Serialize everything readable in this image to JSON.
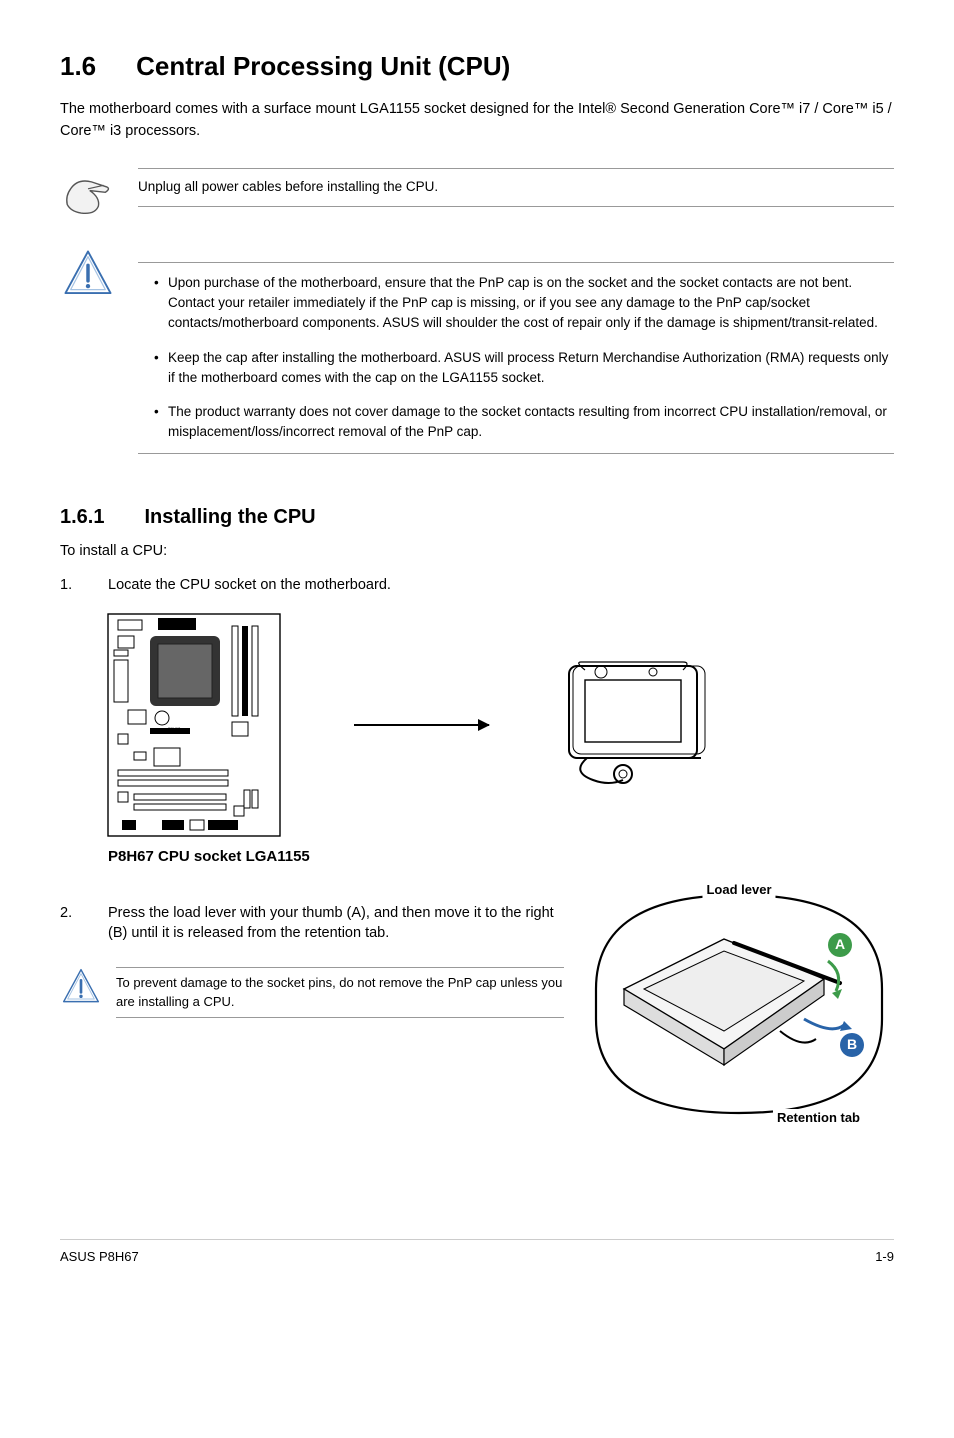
{
  "section": {
    "number": "1.6",
    "title": "Central Processing Unit (CPU)"
  },
  "intro": "The motherboard comes with a surface mount LGA1155 socket designed for the Intel® Second Generation Core™ i7 / Core™ i5 / Core™ i3 processors.",
  "pointing_note": "Unplug all power cables before installing the CPU.",
  "caution_bullets": [
    "Upon purchase of the motherboard, ensure that the PnP cap is on the socket and the socket contacts are not bent. Contact your retailer immediately if the PnP cap is missing, or if you see any damage to the PnP cap/socket contacts/motherboard components. ASUS will shoulder the cost of repair only if the damage is shipment/transit-related.",
    "Keep the cap after installing the motherboard. ASUS will process Return Merchandise Authorization (RMA) requests only if the motherboard comes with the cap on the LGA1155 socket.",
    "The product warranty does not cover damage to the socket contacts resulting from incorrect CPU installation/removal, or misplacement/loss/incorrect removal of the PnP cap."
  ],
  "subsection": {
    "number": "1.6.1",
    "title": "Installing the CPU"
  },
  "install_intro": "To install a CPU:",
  "steps": {
    "s1_num": "1.",
    "s1_text": "Locate the CPU socket on the motherboard.",
    "s2_num": "2.",
    "s2_text": "Press the load lever with your thumb (A), and then move it to the right (B) until it is released from the retention tab."
  },
  "figure_caption": "P8H67 CPU socket LGA1155",
  "inline_caution": "To prevent damage to the socket pins, do not remove the PnP cap unless you are installing a CPU.",
  "callout": {
    "load_lever": "Load lever",
    "retention_tab": "Retention tab",
    "badgeA": "A",
    "badgeB": "B"
  },
  "footer": {
    "left": "ASUS P8H67",
    "right": "1-9"
  }
}
